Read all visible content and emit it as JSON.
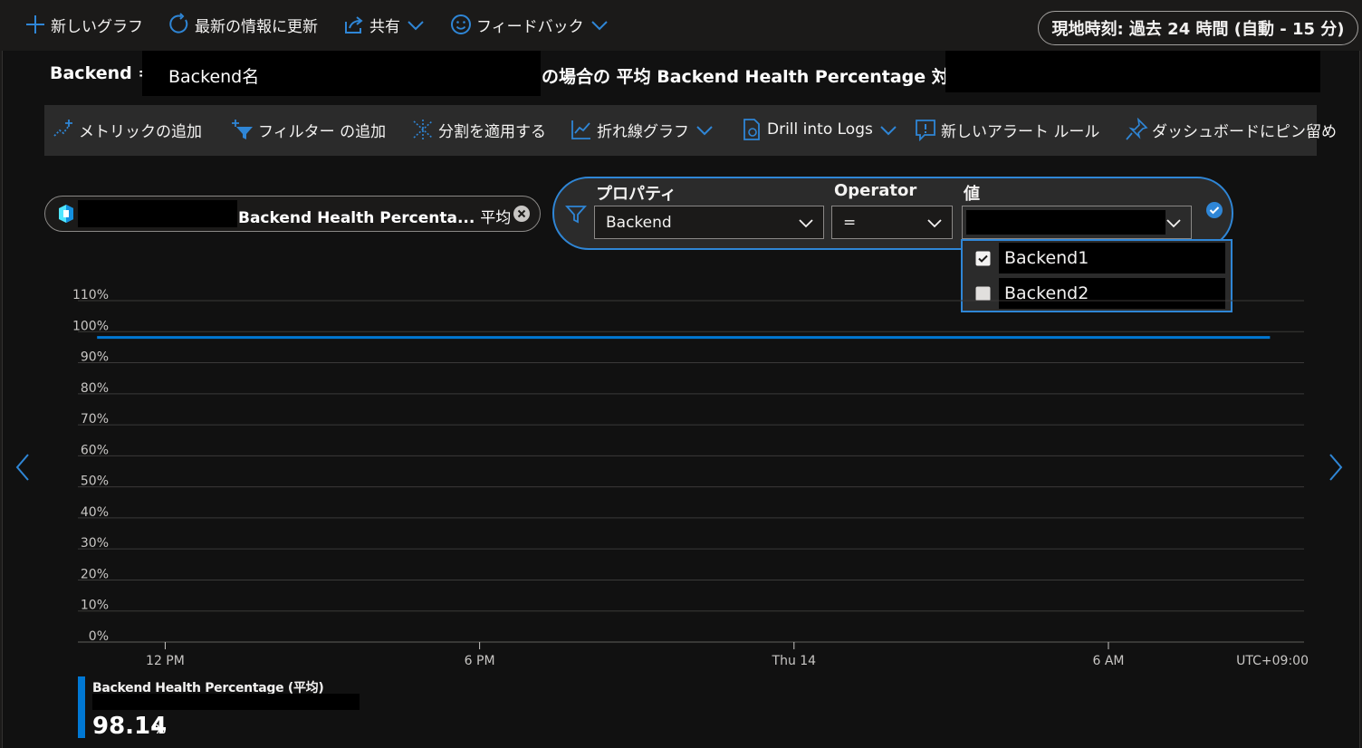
{
  "toolbar": {
    "new_chart": "新しいグラフ",
    "refresh": "最新の情報に更新",
    "share": "共有",
    "feedback": "フィードバック",
    "time_range": "現地時刻: 過去 24 時間 (自動 - 15 分)"
  },
  "title": {
    "prefix": "Backend =",
    "backend_name": "Backend名",
    "middle": "の場合の 平均 Backend Health Percentage 対象"
  },
  "commands": {
    "add_metric": "メトリックの追加",
    "add_filter": "フィルター の追加",
    "apply_split": "分割を適用する",
    "line_chart": "折れ線グラフ",
    "drill_logs": "Drill into Logs",
    "new_alert": "新しいアラート ルール",
    "pin_dashboard": "ダッシュボードにピン留め"
  },
  "metric_pill": {
    "label": "Backend Health Percenta...",
    "aggregation": "平均"
  },
  "filter": {
    "property_label": "プロパティ",
    "property_value": "Backend",
    "operator_label": "Operator",
    "operator_value": "=",
    "value_label": "値",
    "value_value": "",
    "options": [
      {
        "label": "Backend1",
        "checked": true
      },
      {
        "label": "Backend2",
        "checked": false
      }
    ]
  },
  "chart_data": {
    "type": "line",
    "ylim": [
      0,
      110
    ],
    "y_ticks": [
      "0%",
      "10%",
      "20%",
      "30%",
      "40%",
      "50%",
      "60%",
      "70%",
      "80%",
      "90%",
      "100%",
      "110%"
    ],
    "x_ticks": [
      "12 PM",
      "6 PM",
      "Thu 14",
      "6 AM"
    ],
    "timezone": "UTC+09:00",
    "series": [
      {
        "name": "Backend Health Percentage (平均)",
        "color": "#0078d4",
        "x": [
          "10:20",
          "12 PM",
          "6 PM",
          "Thu 14",
          "6 AM",
          "09:40"
        ],
        "values": [
          98.14,
          98.14,
          98.14,
          98.14,
          98.14,
          98.14
        ]
      }
    ]
  },
  "legend": {
    "name": "Backend Health Percentage (平均)",
    "value": "98.14",
    "unit": "%"
  },
  "colors": {
    "accent": "#2f86d6",
    "series": "#0078d4",
    "background": "#111111"
  }
}
